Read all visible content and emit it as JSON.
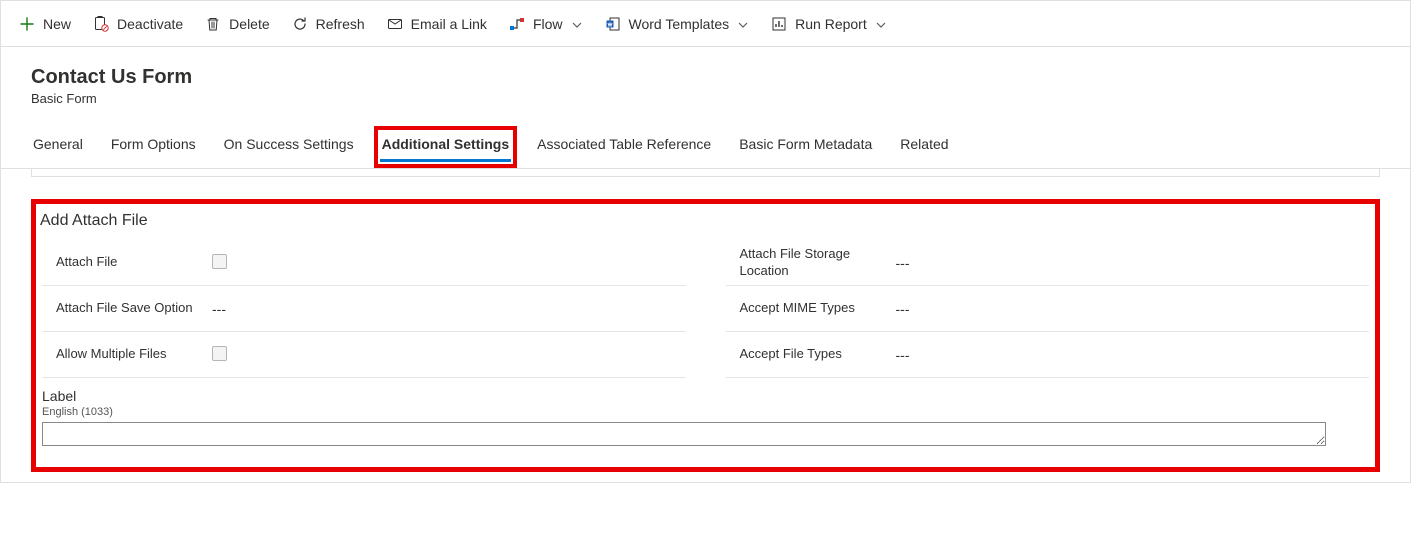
{
  "toolbar": {
    "new": "New",
    "deactivate": "Deactivate",
    "delete": "Delete",
    "refresh": "Refresh",
    "email_link": "Email a Link",
    "flow": "Flow",
    "word_templates": "Word Templates",
    "run_report": "Run Report"
  },
  "header": {
    "title": "Contact Us Form",
    "subtitle": "Basic Form"
  },
  "tabs": {
    "general": "General",
    "form_options": "Form Options",
    "on_success": "On Success Settings",
    "additional": "Additional Settings",
    "associated_table": "Associated Table Reference",
    "metadata": "Basic Form Metadata",
    "related": "Related",
    "active": "additional"
  },
  "section": {
    "title": "Add Attach File",
    "left": {
      "attach_file": {
        "label": "Attach File",
        "checked": false
      },
      "save_option": {
        "label": "Attach File Save Option",
        "value": "---"
      },
      "allow_multiple": {
        "label": "Allow Multiple Files",
        "checked": false
      }
    },
    "right": {
      "storage_location": {
        "label": "Attach File Storage Location",
        "value": "---"
      },
      "mime_types": {
        "label": "Accept MIME Types",
        "value": "---"
      },
      "file_types": {
        "label": "Accept File Types",
        "value": "---"
      }
    },
    "label_block": {
      "heading": "Label",
      "lang": "English (1033)",
      "value": ""
    }
  }
}
